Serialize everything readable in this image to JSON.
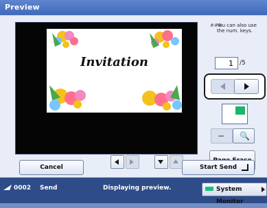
{
  "window": {
    "title": "Preview"
  },
  "preview": {
    "document_text": "Invitation",
    "num_keys_note": "You can also use the num. keys.",
    "current_page": "1",
    "total_pages": "/5"
  },
  "controls": {
    "page_erase_label": "Page Erase",
    "zoom_out_icon": "zoom-out-icon",
    "zoom_in_icon": "zoom-in-icon"
  },
  "buttons": {
    "cancel_label": "Cancel",
    "start_send_label": "Start Send"
  },
  "status": {
    "job_number": "0002",
    "job_action": "Send",
    "message": "Displaying preview.",
    "system_monitor_label": "System Monitor"
  },
  "colors": {
    "header_blue": "#3f69b9",
    "panel_bg": "#e8edf7",
    "status_bg": "#2e4c88",
    "accent_green": "#19b66c"
  }
}
